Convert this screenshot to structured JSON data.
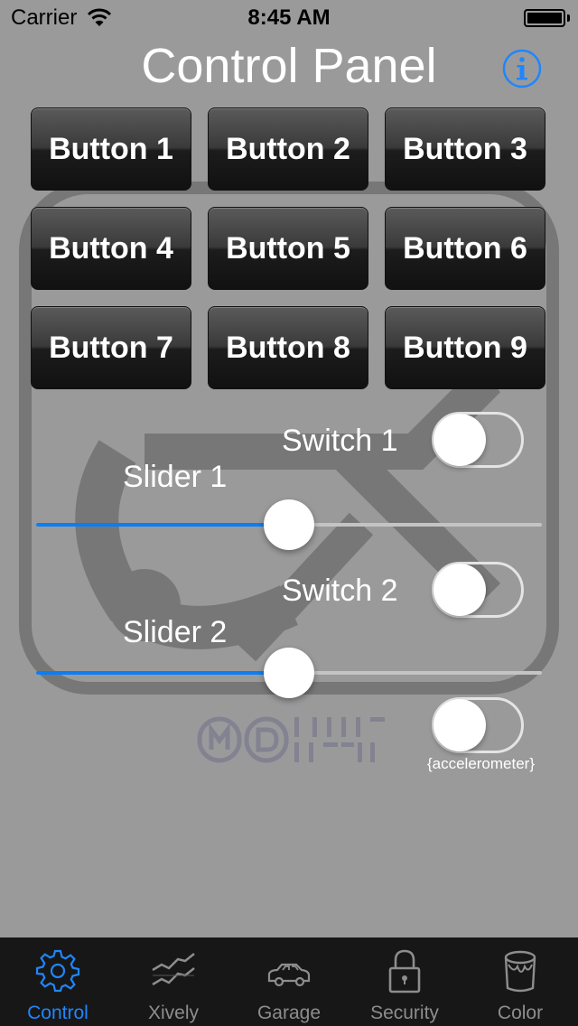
{
  "status": {
    "carrier": "Carrier",
    "time": "8:45 AM"
  },
  "header": {
    "title": "Control Panel",
    "info_icon": "info-circle-icon"
  },
  "buttons": [
    "Button 1",
    "Button 2",
    "Button 3",
    "Button 4",
    "Button 5",
    "Button 6",
    "Button 7",
    "Button 8",
    "Button 9"
  ],
  "switch1": {
    "label": "Switch 1",
    "on": false
  },
  "slider1": {
    "label": "Slider 1",
    "value": 0.5
  },
  "switch2": {
    "label": "Switch 2",
    "on": false
  },
  "slider2": {
    "label": "Slider 2",
    "value": 0.5
  },
  "accelerometer": {
    "label": "{accelerometer}",
    "on": false
  },
  "colors": {
    "accent": "#1f86ff",
    "slider_fill": "#0a7ef5",
    "background": "#9b9a9b",
    "tabbar": "#171717"
  },
  "tabs": [
    {
      "label": "Control",
      "icon": "gear-icon",
      "active": true
    },
    {
      "label": "Xively",
      "icon": "chart-lines-icon",
      "active": false
    },
    {
      "label": "Garage",
      "icon": "car-icon",
      "active": false
    },
    {
      "label": "Security",
      "icon": "lock-icon",
      "active": false
    },
    {
      "label": "Color",
      "icon": "paint-bucket-icon",
      "active": false
    }
  ]
}
